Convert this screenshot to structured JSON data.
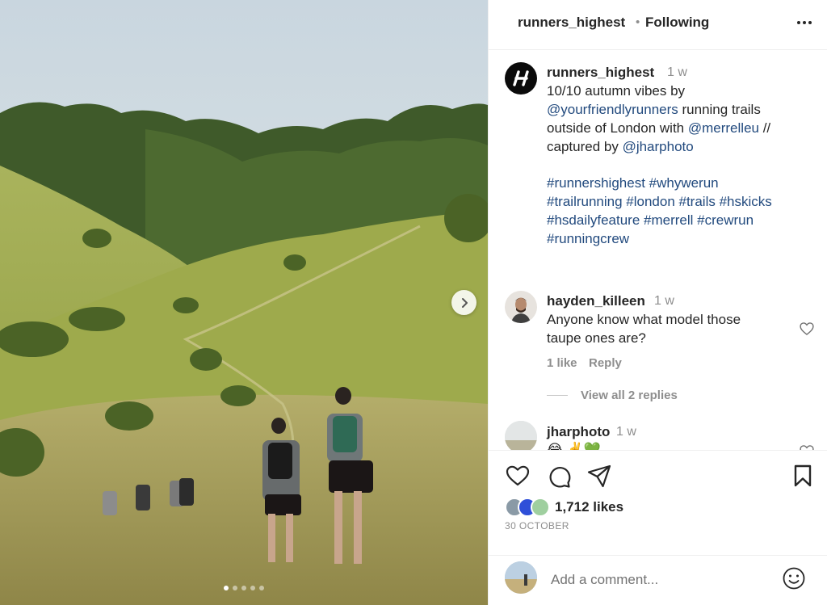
{
  "post": {
    "username": "runners_highest",
    "separator": "•",
    "follow_status": "Following",
    "image_alt": "Group of trail runners running down a grassy valley path in autumn",
    "carousel_total": 5,
    "carousel_active": 1
  },
  "caption": {
    "username": "runners_highest",
    "time": "1 w",
    "line1": "10/10 autumn vibes by",
    "mention1": "@yourfriendlyrunners",
    "line2_rest": " running trails",
    "line3_start": "outside of London with ",
    "mention2": "@merrelleu",
    "line3_end": " //",
    "line4_start": "captured by ",
    "mention3": "@jharphoto",
    "tags_line1": "#runnershighest #whywerun",
    "tags_line2": "#trailrunning #london #trails #hskicks",
    "tags_line3": "#hsdailyfeature #merrell #crewrun",
    "tags_line4": "#runningcrew"
  },
  "comments": [
    {
      "username": "hayden_killeen",
      "time": "1 w",
      "text_line1": "Anyone know what model those",
      "text_line2": "taupe ones are?",
      "likes": "1 like",
      "reply_label": "Reply",
      "view_replies": "View all 2 replies"
    },
    {
      "username": "jharphoto",
      "time": "1 w",
      "text": "😂 ✌️💚"
    }
  ],
  "engagement": {
    "likes": "1,712 likes",
    "date": "30 OCTOBER"
  },
  "composer": {
    "placeholder": "Add a comment..."
  },
  "colors": {
    "link": "#224a7e",
    "muted": "#8e8e8e",
    "text": "#262626",
    "border": "#efefef"
  }
}
